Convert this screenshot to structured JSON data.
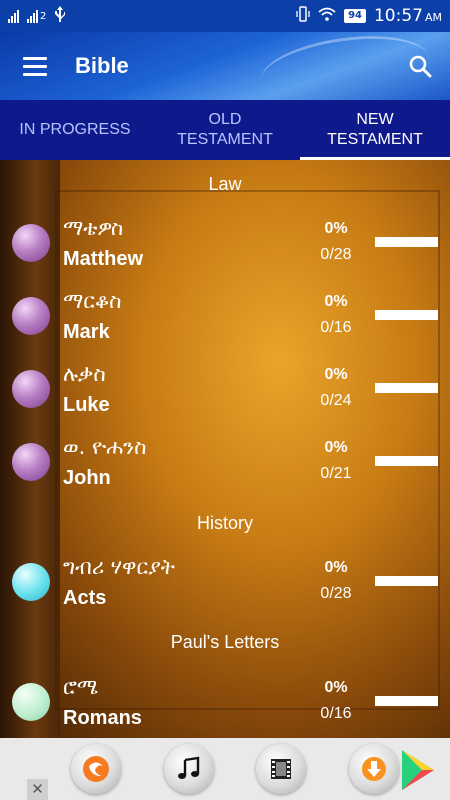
{
  "status_bar": {
    "sim2_label": "2",
    "battery": "94",
    "time": "10:57",
    "ampm": "AM"
  },
  "app_bar": {
    "title": "Bible",
    "menu_icon": "hamburger-menu-icon",
    "search_icon": "search-icon"
  },
  "tabs": [
    {
      "label": "IN PROGRESS",
      "active": false
    },
    {
      "label": "OLD\nTESTAMENT",
      "active": false
    },
    {
      "label": "NEW\nTESTAMENT",
      "active": true
    }
  ],
  "sections": [
    {
      "title": "Law"
    },
    {
      "title": "History"
    },
    {
      "title": "Paul's Letters"
    }
  ],
  "books": [
    {
      "amharic": "ማቴዎስ",
      "english": "Matthew",
      "percent": "0%",
      "count": "0/28",
      "progress": 0,
      "dot": "purple"
    },
    {
      "amharic": "ማርቆስ",
      "english": "Mark",
      "percent": "0%",
      "count": "0/16",
      "progress": 0,
      "dot": "purple"
    },
    {
      "amharic": "ሉቃስ",
      "english": "Luke",
      "percent": "0%",
      "count": "0/24",
      "progress": 0,
      "dot": "purple"
    },
    {
      "amharic": "ወ. ዮሐንስ",
      "english": "John",
      "percent": "0%",
      "count": "0/21",
      "progress": 0,
      "dot": "purple"
    },
    {
      "amharic": "ግብሪ ሃዋርያት",
      "english": "Acts",
      "percent": "0%",
      "count": "0/28",
      "progress": 0,
      "dot": "cyan"
    },
    {
      "amharic": "ሮሜ",
      "english": "Romans",
      "percent": "0%",
      "count": "0/16",
      "progress": 0,
      "dot": "mint"
    }
  ],
  "ad": {
    "close_label": "✕",
    "icons": [
      "uc-browser-icon",
      "music-icon",
      "video-icon",
      "download-icon",
      "play-store-icon"
    ]
  },
  "colors": {
    "status_bar": "#0d3fa8",
    "tab_bar": "#0e1a8c",
    "active_tab_indicator": "#ffffff"
  }
}
